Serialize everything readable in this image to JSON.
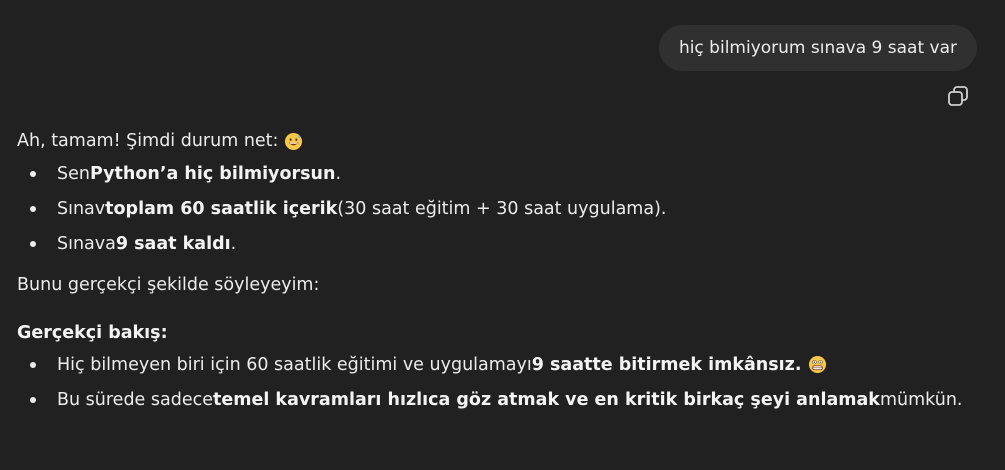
{
  "user_message": "hiç bilmiyorum sınava 9 saat var",
  "icons": {
    "copy": "copy-icon",
    "emoji_intro": "grinning-sweat-emoji",
    "emoji_impossible": "grimacing-emoji"
  },
  "assistant": {
    "intro": "Ah, tamam! Şimdi durum net:",
    "bullets_1": [
      {
        "pre": "Sen ",
        "bold": "Python’a hiç bilmiyorsun",
        "post": "."
      },
      {
        "pre": "Sınav ",
        "bold": "toplam 60 saatlik içerik",
        "post": " (30 saat eğitim + 30 saat uygulama)."
      },
      {
        "pre": "Sınava ",
        "bold": "9 saat kaldı",
        "post": "."
      }
    ],
    "realistic_intro": "Bunu gerçekçi şekilde söyleyeyim:",
    "heading": "Gerçekçi bakış:",
    "bullets_2": [
      {
        "pre": "Hiç bilmeyen biri için 60 saatlik eğitimi ve uygulamayı ",
        "bold": "9 saatte bitirmek imkânsız.",
        "post": ""
      },
      {
        "pre": "Bu sürede sadece ",
        "bold": "temel kavramları hızlıca göz atmak ve en kritik birkaç şeyi anlamak",
        "post": " mümkün."
      }
    ]
  },
  "colors": {
    "background": "#212121",
    "user_bubble": "#303030",
    "text": "#ececec"
  }
}
